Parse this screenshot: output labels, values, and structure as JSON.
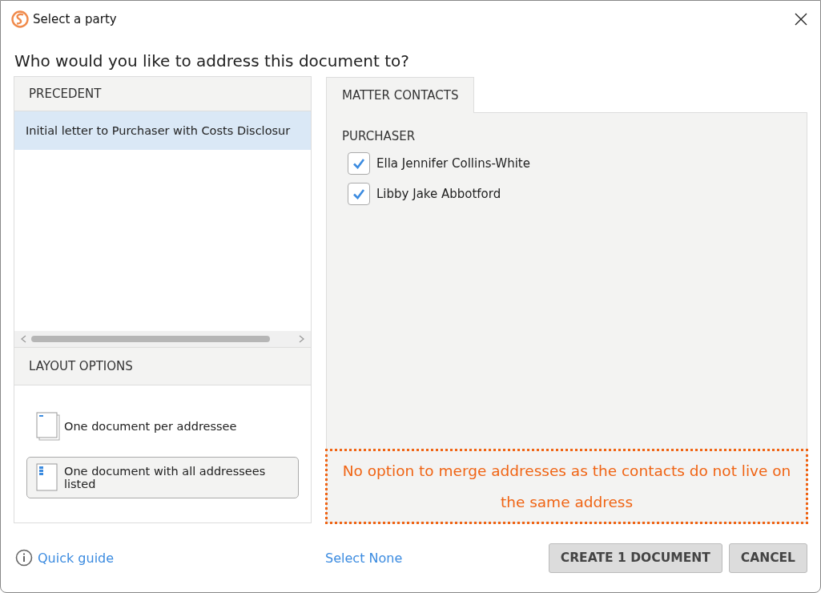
{
  "window": {
    "title": "Select a party"
  },
  "heading": "Who would you like to address this document to?",
  "precedent": {
    "header": "PRECEDENT",
    "items": [
      {
        "label": "Initial letter to Purchaser with Costs Disclosur",
        "selected": true
      }
    ]
  },
  "layout_options": {
    "header": "LAYOUT OPTIONS",
    "items": [
      {
        "label": "One document per addressee",
        "selected": false,
        "kind": "per-addressee"
      },
      {
        "label": "One document with all addressees listed",
        "selected": true,
        "kind": "all-listed"
      }
    ]
  },
  "tabs": [
    {
      "label": "MATTER CONTACTS",
      "selected": true
    }
  ],
  "contact_groups": [
    {
      "title": "PURCHASER",
      "contacts": [
        {
          "name": "Ella Jennifer Collins-White",
          "checked": true
        },
        {
          "name": "Libby Jake Abbotford",
          "checked": true
        }
      ]
    }
  ],
  "annotation": "No option to merge addresses as the contacts do not live on the same address",
  "footer": {
    "quick_guide": "Quick guide",
    "select_none": "Select None",
    "buttons": [
      "CREATE 1 DOCUMENT",
      "CANCEL"
    ]
  }
}
